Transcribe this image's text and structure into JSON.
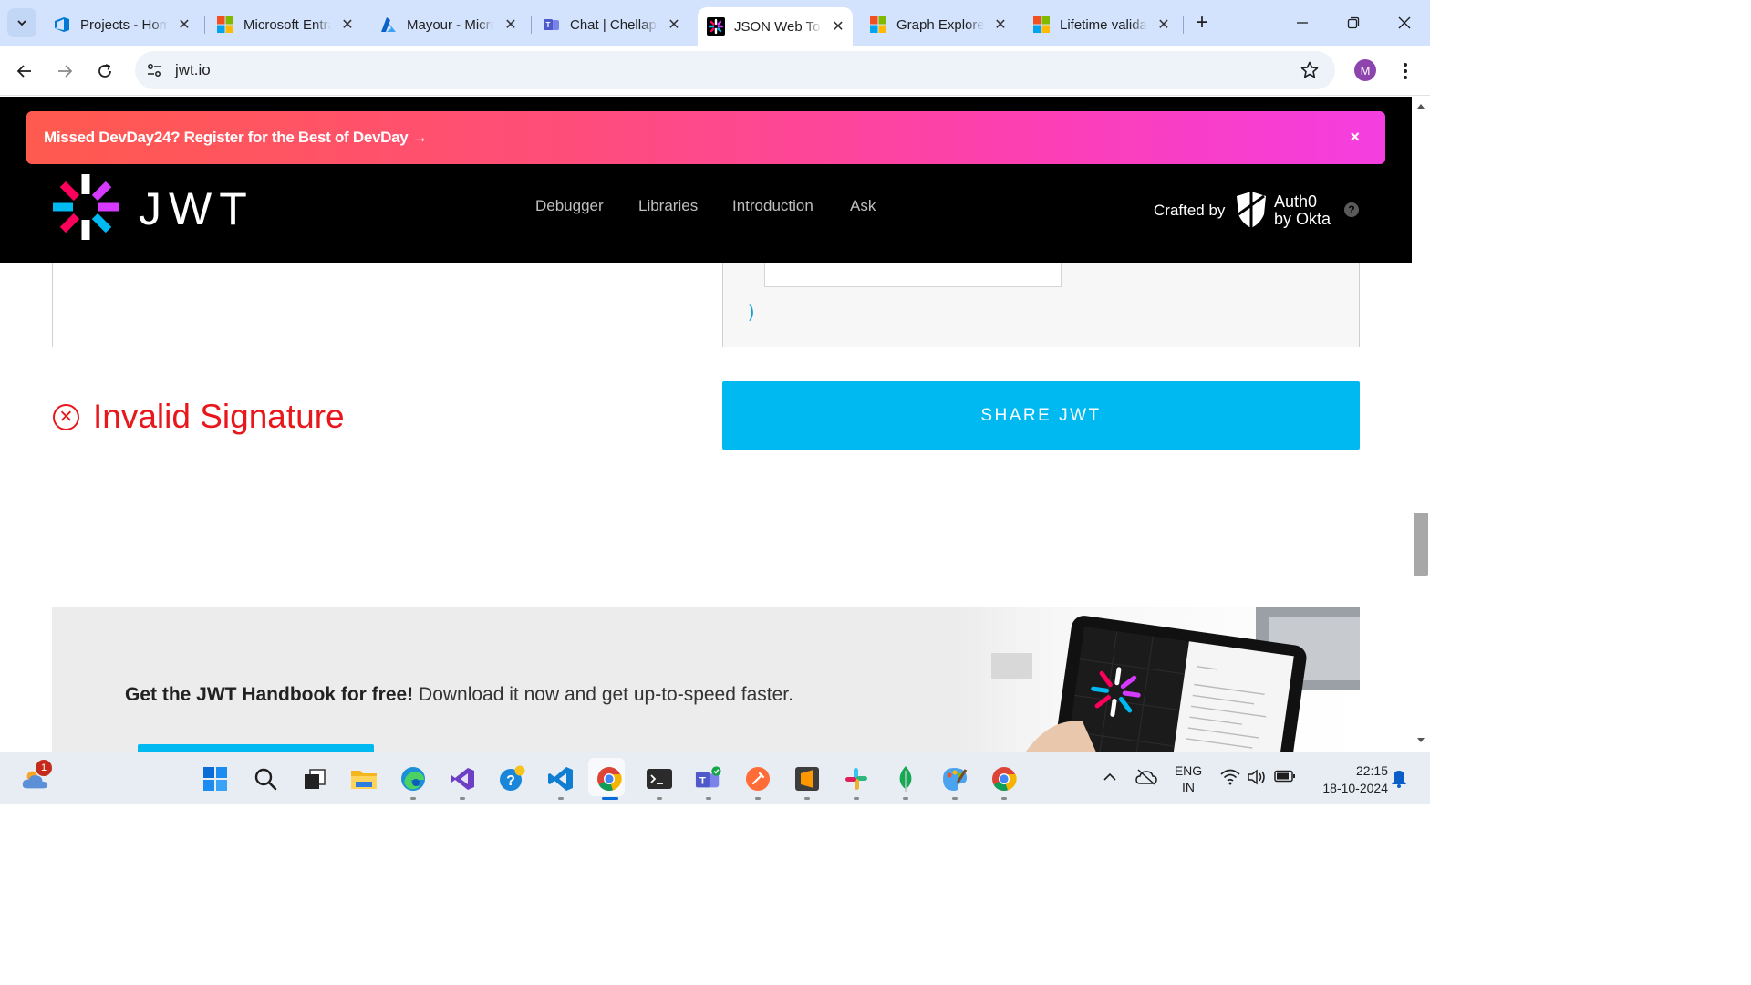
{
  "browser": {
    "tabs": [
      {
        "title": "Projects - Home",
        "icon": "azure-devops-icon",
        "active": false
      },
      {
        "title": "Microsoft Entra",
        "icon": "microsoft-icon",
        "active": false
      },
      {
        "title": "Mayour - Microsoft",
        "icon": "azure-icon",
        "active": false
      },
      {
        "title": "Chat | Chellappa",
        "icon": "teams-icon",
        "active": false
      },
      {
        "title": "JSON Web Tokens",
        "icon": "jwt-icon",
        "active": true
      },
      {
        "title": "Graph Explorer",
        "icon": "microsoft-icon",
        "active": false
      },
      {
        "title": "Lifetime validation",
        "icon": "microsoft-icon",
        "active": false
      }
    ],
    "new_tab": "+",
    "url": "jwt.io",
    "profile_initial": "M"
  },
  "page": {
    "banner": {
      "text": "Missed DevDay24? Register for the Best of DevDay",
      "arrow": "→",
      "close": "×"
    },
    "logo_text": "JWT",
    "nav": [
      "Debugger",
      "Libraries",
      "Introduction",
      "Ask"
    ],
    "crafted_by": "Crafted by",
    "auth0_line1": "Auth0",
    "auth0_line2": "by Okta",
    "help": "?",
    "closing_paren": ")",
    "signature_status": "Invalid Signature",
    "share_button": "SHARE JWT",
    "handbook": {
      "bold": "Get the JWT Handbook for free!",
      "rest": " Download it now and get up-to-speed faster."
    }
  },
  "taskbar": {
    "weather_badge": "1",
    "language_line1": "ENG",
    "language_line2": "IN",
    "time": "22:15",
    "date": "18-10-2024"
  },
  "colors": {
    "accent_blue": "#00b9f1",
    "error_red": "#e8171c",
    "banner_start": "#ff5a4e",
    "banner_end": "#f43ee0",
    "tabstrip": "#d3e3fd"
  }
}
